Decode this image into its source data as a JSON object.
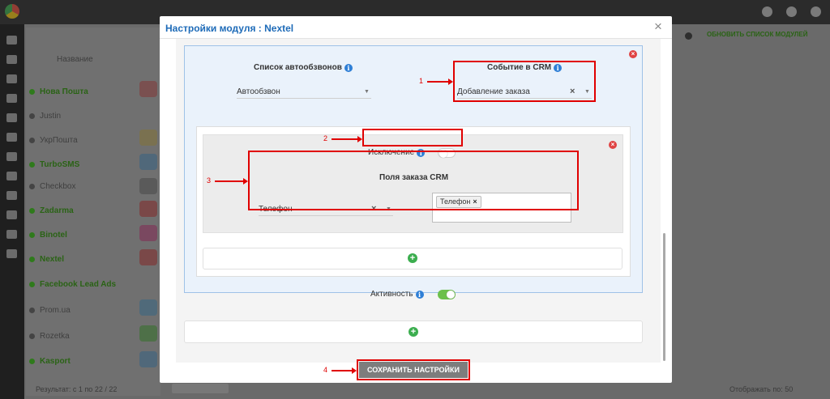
{
  "background": {
    "column_header": "Название",
    "top_right_button": "Обновить список модулей",
    "list": [
      {
        "label": "Нова Пошта",
        "active": true
      },
      {
        "label": "Justin",
        "active": false
      },
      {
        "label": "УкрПошта",
        "active": false
      },
      {
        "label": "TurboSMS",
        "active": true
      },
      {
        "label": "Checkbox",
        "active": false
      },
      {
        "label": "Zadarma",
        "active": true
      },
      {
        "label": "Binotel",
        "active": true
      },
      {
        "label": "Nextel",
        "active": true
      },
      {
        "label": "Facebook Lead Ads",
        "active": true
      },
      {
        "label": "Prom.ua",
        "active": false
      },
      {
        "label": "Rozetka",
        "active": false
      },
      {
        "label": "Kasport",
        "active": true
      }
    ],
    "footer_left": "Результат: с 1 по 22 / 22",
    "footer_right": "Отображать по: 50"
  },
  "modal": {
    "title": "Настройки модуля : Nextel",
    "autodial": {
      "label": "Список автообзвонов",
      "value": "Автообзвон"
    },
    "crm_event": {
      "label": "Событие в CRM",
      "value": "Добавление заказа"
    },
    "exception": {
      "label": "Исключение",
      "enabled": false
    },
    "crm_fields": {
      "label": "Поля заказа CRM",
      "value": "Телефон",
      "tags": [
        "Телефон"
      ]
    },
    "activity": {
      "label": "Активность",
      "enabled": true
    },
    "save_label": "Сохранить настройки"
  },
  "annotations": {
    "n1": "1",
    "n2": "2",
    "n3": "3",
    "n4": "4"
  },
  "colors": {
    "accent": "#1e6bb8",
    "success": "#3cae4f",
    "danger": "#e04343",
    "annotation": "#e00000"
  }
}
